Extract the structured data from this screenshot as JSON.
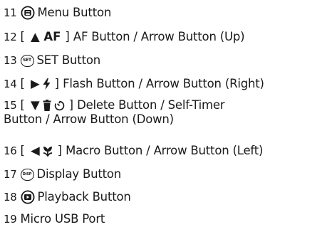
{
  "items": [
    {
      "num": "11",
      "text": "Menu Button",
      "icon": "menu-button-icon"
    },
    {
      "num": "12",
      "prefix": "[",
      "glyph": "▲ AF",
      "suffix": "]",
      "text": "AF Button / Arrow Button (Up)",
      "icon": "arrow-up-icon"
    },
    {
      "num": "13",
      "text": "SET Button",
      "icon": "set-button-icon",
      "badge": "SET"
    },
    {
      "num": "14",
      "prefix": "[",
      "glyph": "▶",
      "suffix": "]",
      "text": "Flash Button / Arrow Button (Right)",
      "icon": "flash-icon"
    },
    {
      "num": "15",
      "prefix": "[",
      "glyph": "▼",
      "suffix": "]",
      "text": "Delete Button / Self-Timer",
      "text2": "Button / Arrow Button (Down)",
      "icon": "delete-timer-icon"
    },
    {
      "num": "16",
      "prefix": "[",
      "glyph": "◀",
      "suffix": "]",
      "text": "Macro Button / Arrow Button (Left)",
      "icon": "macro-icon"
    },
    {
      "num": "17",
      "text": "Display Button",
      "icon": "disp-button-icon",
      "badge": "DISP"
    },
    {
      "num": "18",
      "text": "Playback Button",
      "icon": "playback-button-icon"
    },
    {
      "num": "19",
      "text": "Micro USB Port"
    }
  ]
}
